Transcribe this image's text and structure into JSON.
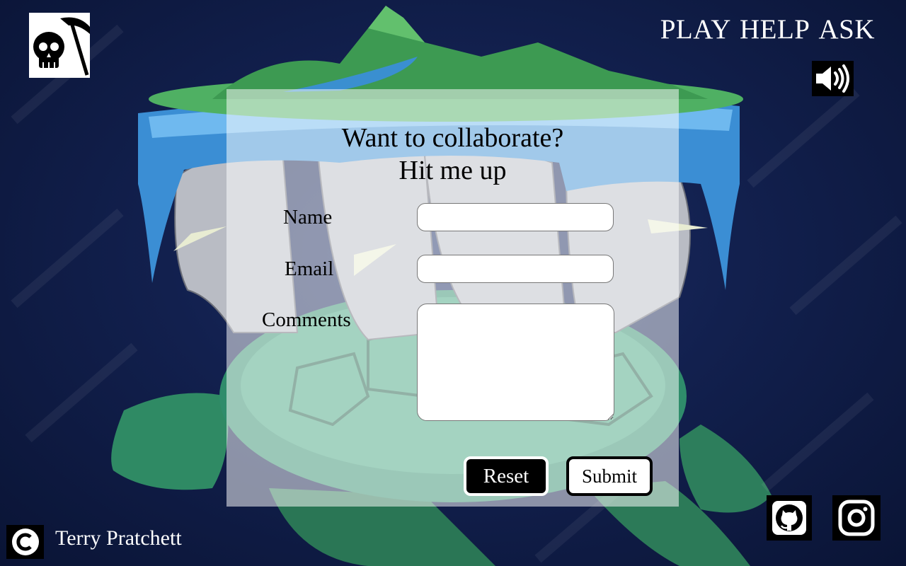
{
  "nav": {
    "items": [
      "PLAY",
      "HELP",
      "ASK"
    ]
  },
  "form": {
    "title_line1": "Want to collaborate?",
    "title_line2": "Hit me up",
    "name_label": "Name",
    "email_label": "Email",
    "comments_label": "Comments",
    "reset_label": "Reset",
    "submit_label": "Submit"
  },
  "footer": {
    "author": "Terry Pratchett"
  },
  "icons": {
    "logo": "skull-scythe-icon",
    "sound": "speaker-volume-icon",
    "copyright": "copyright-icon",
    "github": "github-icon",
    "instagram": "instagram-icon"
  },
  "colors": {
    "background": "#12204e",
    "panel": "rgba(255,255,255,0.52)",
    "reset_bg": "#000000",
    "submit_bg": "#ffffff"
  }
}
